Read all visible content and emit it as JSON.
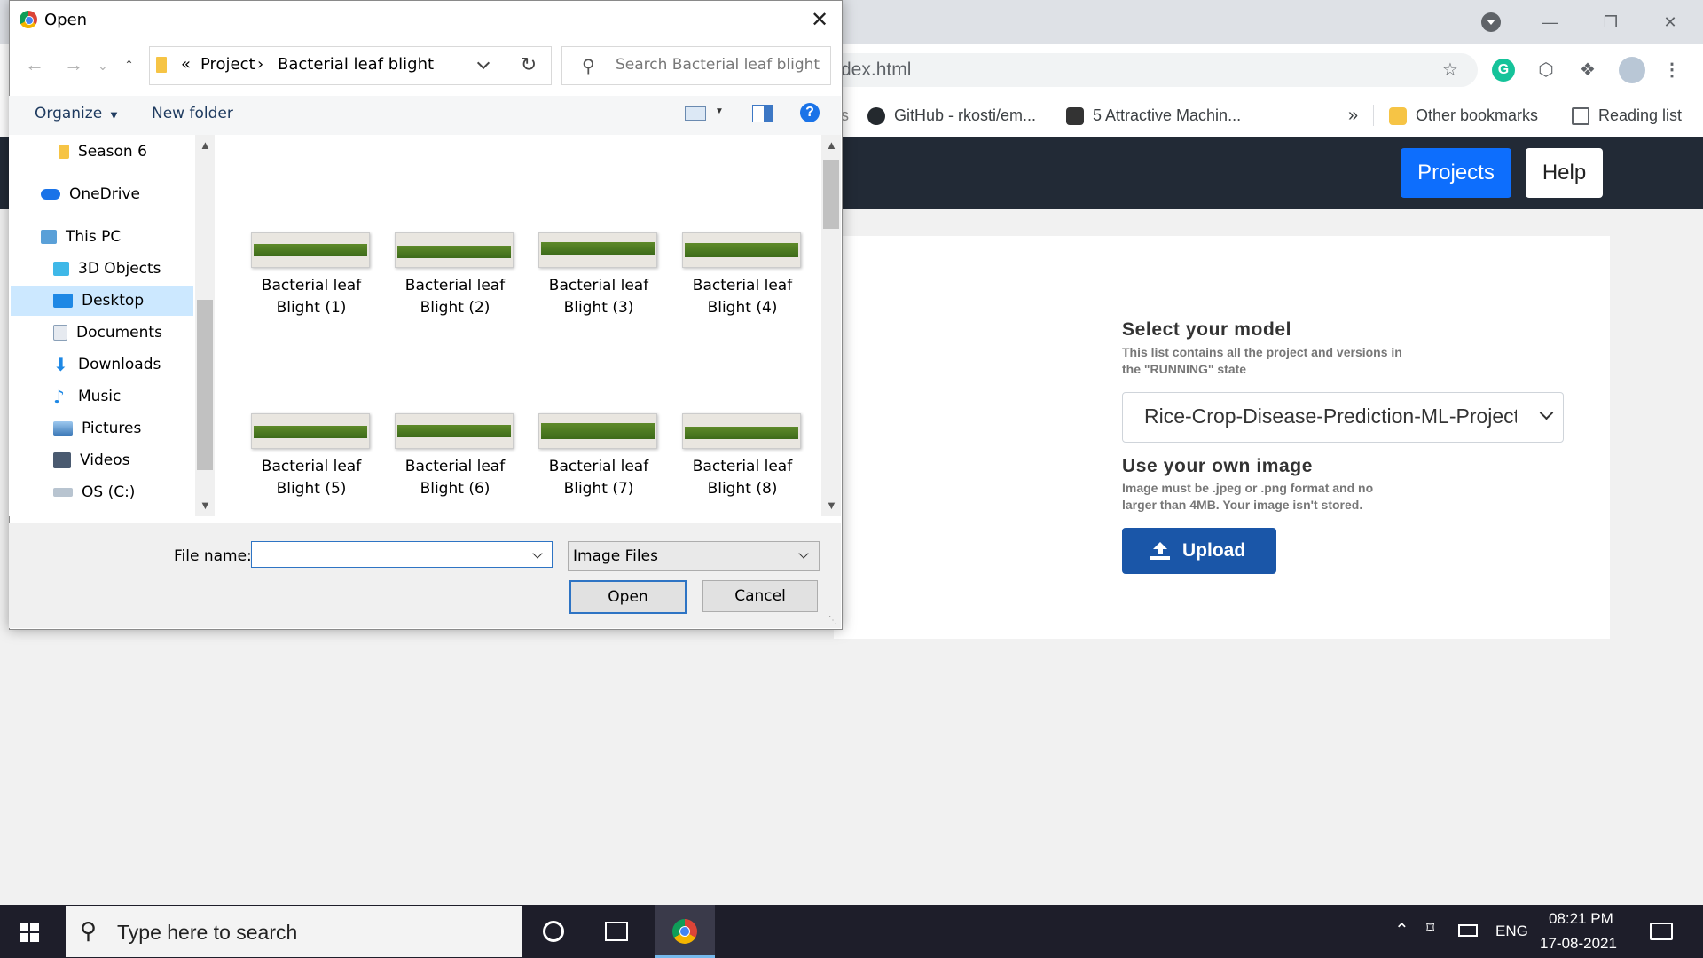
{
  "browser": {
    "address_partial": "dex.html",
    "bookmarks": [
      {
        "label": "GitHub - rkosti/em..."
      },
      {
        "label": "5 Attractive Machin..."
      }
    ],
    "bookmarks_overflow": "»",
    "other_bookmarks": "Other bookmarks",
    "reading_list": "Reading list",
    "partial_tab_char": "s"
  },
  "page": {
    "nav": {
      "projects": "Projects",
      "help": "Help"
    },
    "select_model": {
      "title": "Select your model",
      "description": "This list contains all the project and versions in the \"RUNNING\" state",
      "selected": "Rice-Crop-Disease-Prediction-ML-Project"
    },
    "own_image": {
      "title": "Use your own image",
      "description": "Image must be .jpeg or .png format and no larger than 4MB. Your image isn't stored."
    },
    "upload_label": "Upload"
  },
  "dialog": {
    "title": "Open",
    "breadcrumb": {
      "overflow": "«",
      "items": [
        "Project",
        "Bacterial leaf blight"
      ]
    },
    "search_placeholder": "Search Bacterial leaf blight",
    "commands": {
      "organize": "Organize",
      "new_folder": "New folder"
    },
    "nav_items": [
      {
        "label": "Season 6",
        "icon": "folder-icon"
      },
      {
        "label": "OneDrive",
        "icon": "cloud-icon"
      },
      {
        "label": "This PC",
        "icon": "computer-icon"
      },
      {
        "label": "3D Objects",
        "icon": "cube-icon"
      },
      {
        "label": "Desktop",
        "icon": "desktop-icon",
        "selected": true
      },
      {
        "label": "Documents",
        "icon": "document-icon"
      },
      {
        "label": "Downloads",
        "icon": "download-icon"
      },
      {
        "label": "Music",
        "icon": "music-icon"
      },
      {
        "label": "Pictures",
        "icon": "picture-icon"
      },
      {
        "label": "Videos",
        "icon": "video-icon"
      },
      {
        "label": "OS (C:)",
        "icon": "drive-icon"
      }
    ],
    "files": [
      {
        "line1": "Bacterial leaf",
        "line2": "Blight (1)"
      },
      {
        "line1": "Bacterial leaf",
        "line2": "Blight (2)"
      },
      {
        "line1": "Bacterial leaf",
        "line2": "Blight (3)"
      },
      {
        "line1": "Bacterial leaf",
        "line2": "Blight (4)"
      },
      {
        "line1": "Bacterial leaf",
        "line2": "Blight (5)"
      },
      {
        "line1": "Bacterial leaf",
        "line2": "Blight (6)"
      },
      {
        "line1": "Bacterial leaf",
        "line2": "Blight (7)"
      },
      {
        "line1": "Bacterial leaf",
        "line2": "Blight (8)"
      }
    ],
    "file_name_label": "File name:",
    "file_name_value": "",
    "file_type": "Image Files",
    "open_label": "Open",
    "cancel_label": "Cancel"
  },
  "taskbar": {
    "search_placeholder": "Type here to search",
    "language": "ENG",
    "time": "08:21 PM",
    "date": "17-08-2021"
  },
  "colors": {
    "navbar": "#222a36",
    "projects_button": "#0d6efd",
    "upload_button": "#1a56a8",
    "selected_nav": "#cce8ff"
  }
}
